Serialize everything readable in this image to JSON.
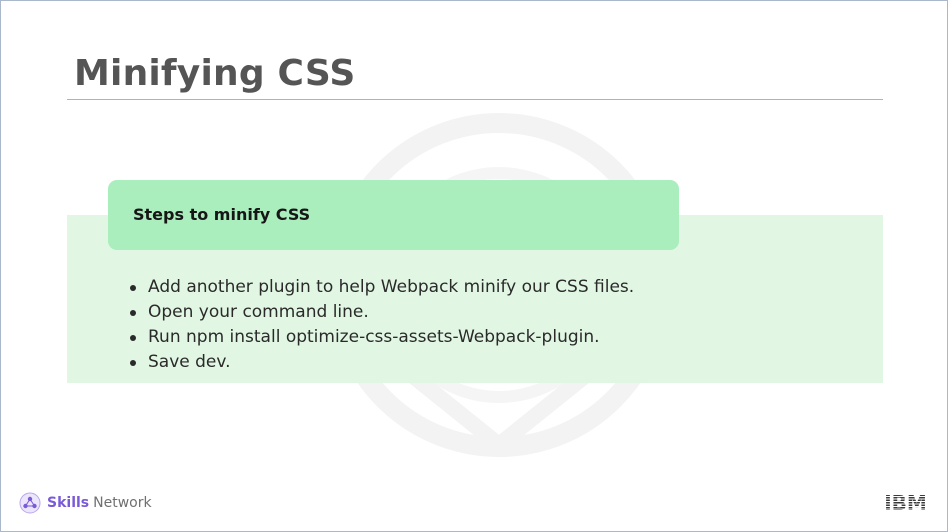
{
  "slide": {
    "title": "Minifying CSS",
    "section_header": "Steps to minify CSS",
    "bullets": [
      "Add another plugin to help Webpack minify our CSS files.",
      "Open your command line.",
      "Run npm install optimize-css-assets-Webpack-plugin.",
      "Save dev."
    ]
  },
  "footer": {
    "brand_bold": "Skills",
    "brand_rest": "Network",
    "brand_icon": "skills-network-icon",
    "logo": "ibm-logo",
    "logo_text": "IBM"
  },
  "colors": {
    "title": "#555555",
    "header_box": "#a9eebc",
    "panel": "#e1f7e4",
    "rule": "#a9b3c4",
    "brand_accent": "#7a5ad6",
    "ibm_logo": "#3a3a3a"
  }
}
